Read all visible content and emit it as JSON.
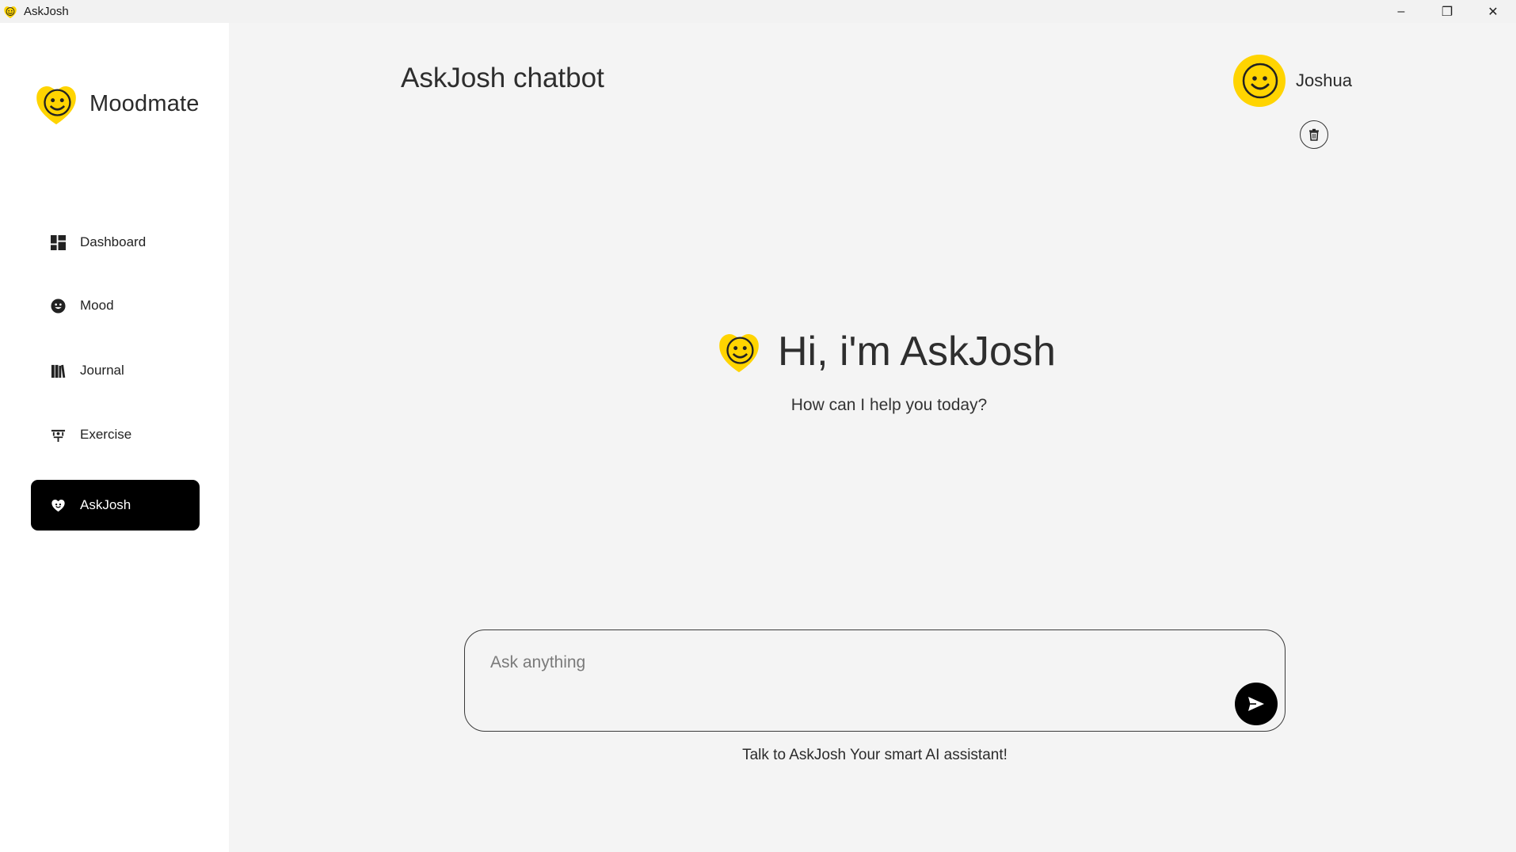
{
  "window": {
    "title": "AskJosh",
    "controls": {
      "minimize": "–",
      "restore": "❐",
      "close": "✕"
    }
  },
  "sidebar": {
    "brand": "Moodmate",
    "items": [
      {
        "label": "Dashboard",
        "icon": "dashboard-icon",
        "active": false
      },
      {
        "label": "Mood",
        "icon": "smiley-icon",
        "active": false
      },
      {
        "label": "Journal",
        "icon": "books-icon",
        "active": false
      },
      {
        "label": "Exercise",
        "icon": "exercise-icon",
        "active": false
      },
      {
        "label": "AskJosh",
        "icon": "heart-chat-icon",
        "active": true
      }
    ]
  },
  "header": {
    "title": "AskJosh chatbot",
    "user_name": "Joshua"
  },
  "hero": {
    "title": "Hi, i'm AskJosh",
    "subtitle": "How can I help you today?"
  },
  "composer": {
    "placeholder": "Ask anything",
    "value": ""
  },
  "footer": {
    "text": "Talk to AskJosh  Your smart AI assistant!"
  },
  "colors": {
    "accent": "#FFD400",
    "active_nav": "#000000",
    "background": "#F4F4F4",
    "sidebar": "#FFFFFF"
  }
}
